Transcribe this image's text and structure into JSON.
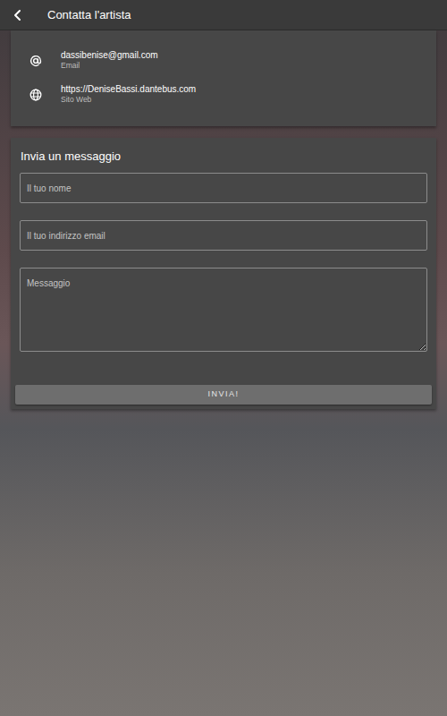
{
  "header": {
    "title": "Contatta l'artista"
  },
  "contacts": [
    {
      "kind": "email",
      "value": "dassibenise@gmail.com",
      "label": "Email"
    },
    {
      "kind": "web",
      "value": "https://DeniseBassi.dantebus.com",
      "label": "Sito Web"
    }
  ],
  "form": {
    "title": "Invia un messaggio",
    "fields": [
      {
        "kind": "input",
        "placeholder": "Il tuo nome"
      },
      {
        "kind": "input",
        "placeholder": "Il tuo indirizzo email"
      },
      {
        "kind": "textarea",
        "placeholder": "Messaggio"
      }
    ],
    "submit": "INVIA!"
  }
}
